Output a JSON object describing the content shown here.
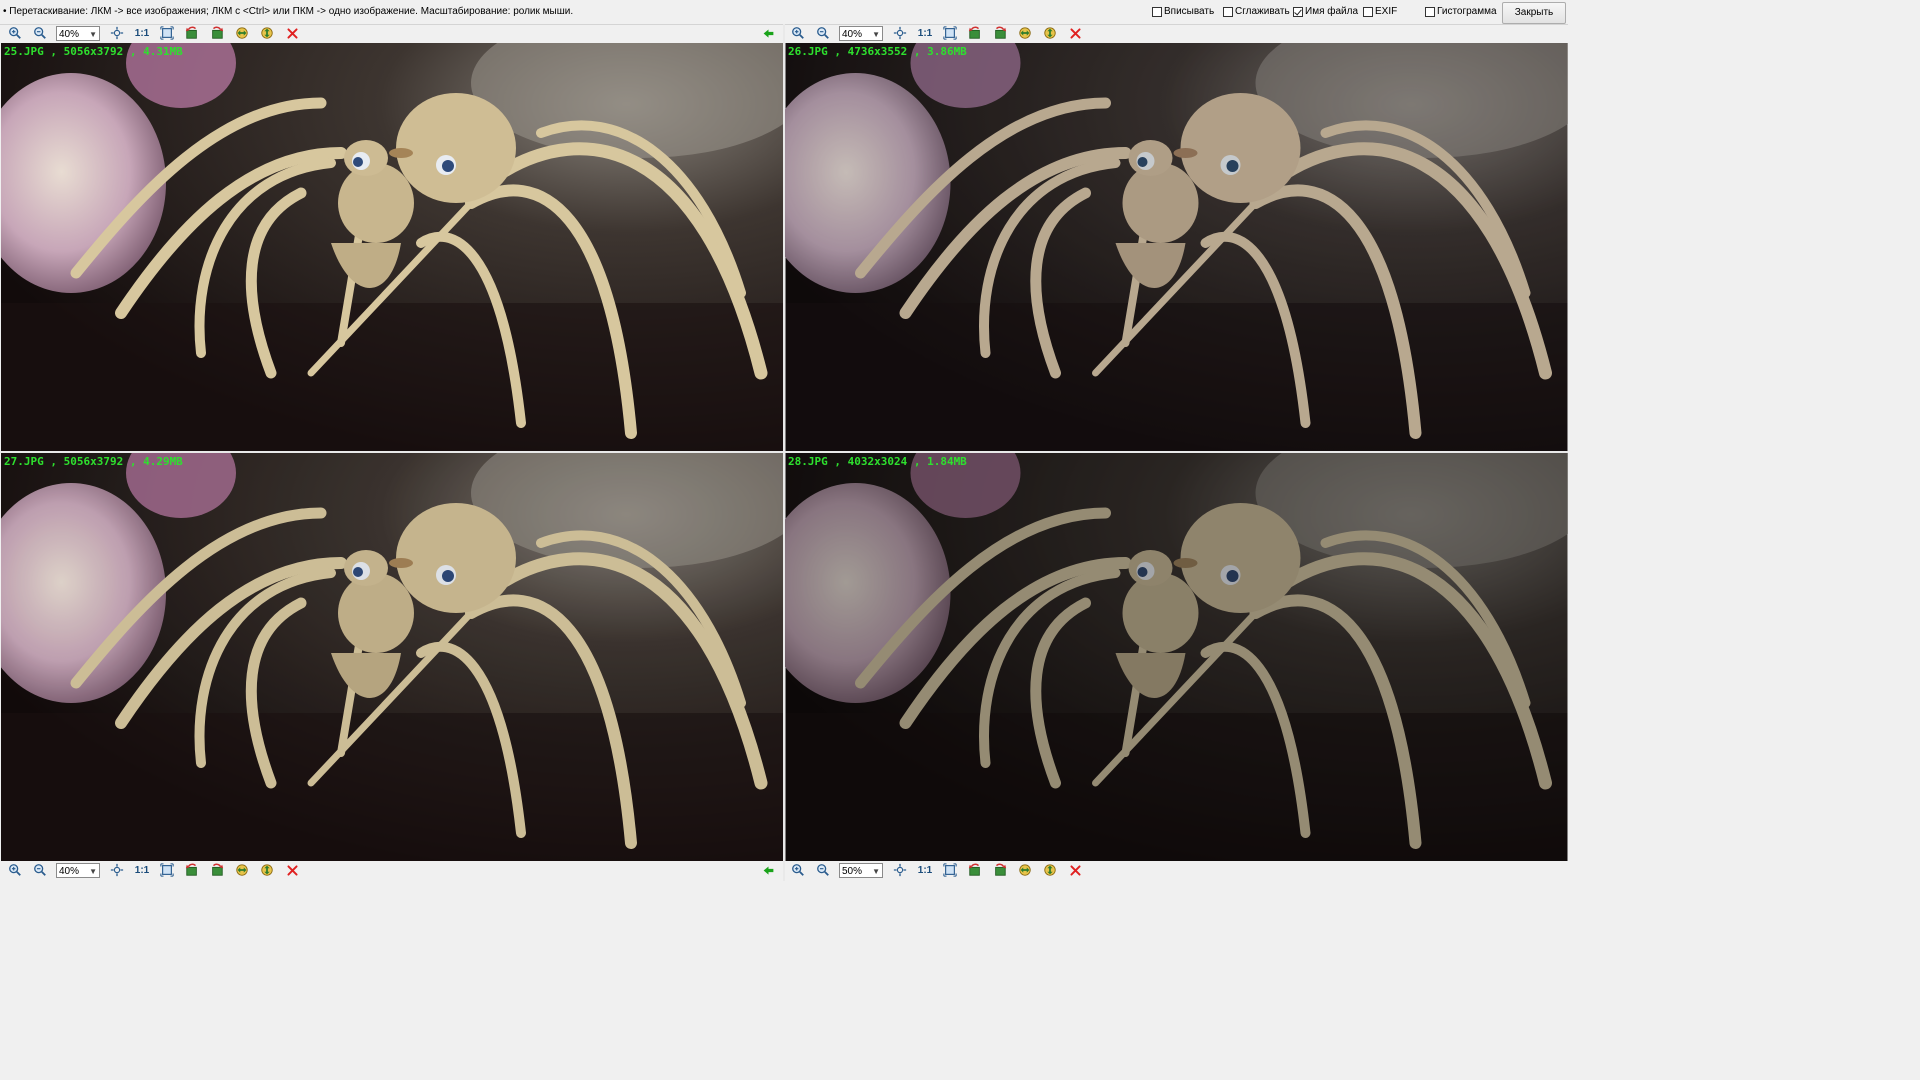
{
  "hint": "• Перетаскивание: ЛКМ -> все изображения; ЛКМ с <Ctrl> или ПКМ -> одно изображение. Масштабирование: ролик мыши.",
  "options": [
    {
      "label": "Вписывать",
      "checked": false
    },
    {
      "label": "Сглаживать",
      "checked": false
    },
    {
      "label": "Имя файла",
      "checked": true
    },
    {
      "label": "EXIF",
      "checked": false
    },
    {
      "label": "Гистограмма",
      "checked": false
    }
  ],
  "close_label": "Закрыть",
  "one_to_one": "1:1",
  "panels": [
    {
      "caption": "25.JPG , 5056x3792 , 4.31MB",
      "zoom": "40%",
      "tone": "warm"
    },
    {
      "caption": "26.JPG , 4736x3552 , 3.86MB",
      "zoom": "40%",
      "tone": "cool"
    },
    {
      "caption": "27.JPG , 5056x3792 , 4.29MB",
      "zoom": "40%",
      "tone": "warm"
    },
    {
      "caption": "28.JPG , 4032x3024 , 1.84MB",
      "zoom": "50%",
      "tone": "dark"
    }
  ],
  "colors": {
    "caption": "#2ee02e",
    "close_x": "#e02020",
    "arrow": "#1aa31a"
  }
}
